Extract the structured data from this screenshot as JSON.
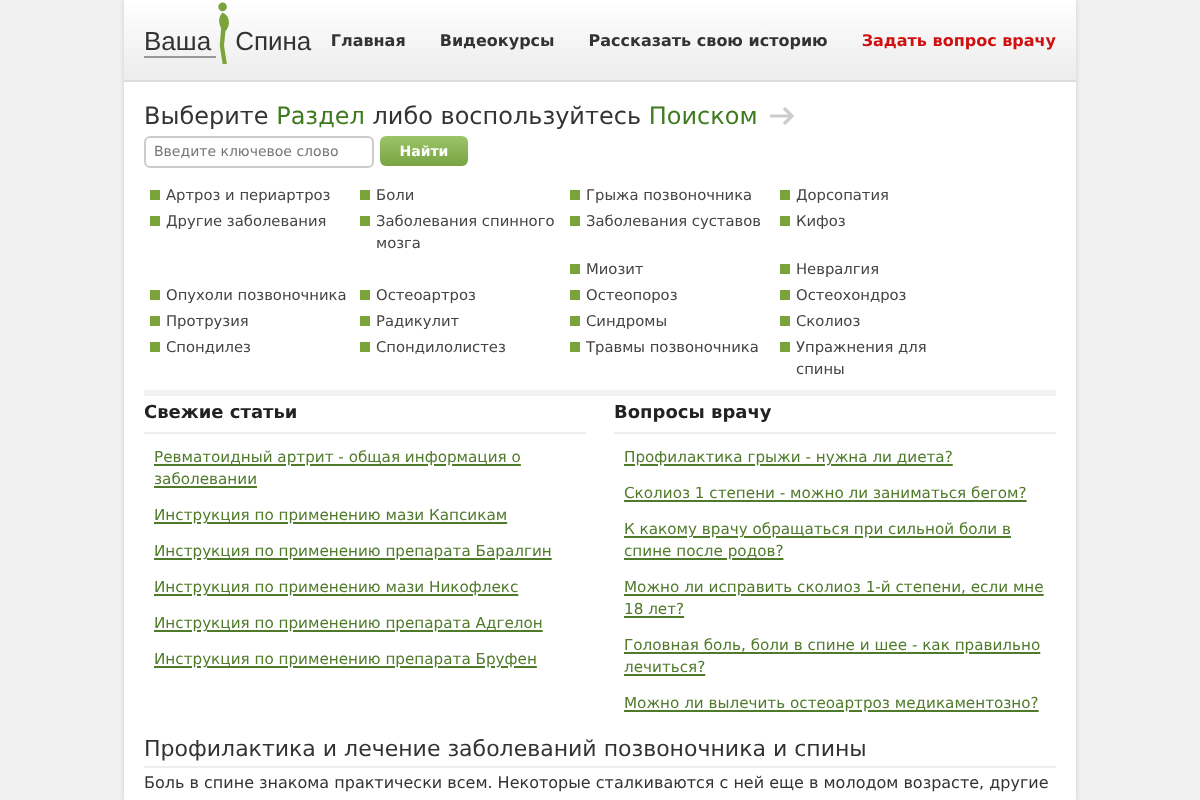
{
  "header": {
    "logo": {
      "word_1": "Ваша",
      "word_2": "Спина"
    },
    "nav": [
      {
        "label": "Главная",
        "highlight": false
      },
      {
        "label": "Видеокурсы",
        "highlight": false
      },
      {
        "label": "Рассказать свою историю",
        "highlight": false
      },
      {
        "label": "Задать вопрос врачу",
        "highlight": true
      }
    ]
  },
  "search": {
    "heading": [
      {
        "text": "Выберите ",
        "accent": false
      },
      {
        "text": "Раздел",
        "accent": true
      },
      {
        "text": " либо воспользуйтесь ",
        "accent": false
      },
      {
        "text": "Поиском",
        "accent": true
      }
    ],
    "placeholder": "Введите ключевое слово",
    "button": "Найти"
  },
  "categories": [
    {
      "column_1": "Артроз и периартроз",
      "column_2": "Боли",
      "column_3": "Грыжа позвоночника",
      "column_4": "Дорсопатия"
    },
    {
      "column_1": "Другие заболевания",
      "column_2": "Заболевания спинного мозга",
      "column_3": "Заболевания суставов",
      "column_4": "Кифоз"
    },
    {
      "column_3": "Миозит",
      "column_4": "Невралгия"
    },
    {
      "column_1": "Опухоли позвоночника",
      "column_2": "Остеоартроз",
      "column_3": "Остеопороз",
      "column_4": "Остеохондроз"
    },
    {
      "column_1": "Протрузия",
      "column_2": "Радикулит",
      "column_3": "Синдромы",
      "column_4": "Сколиоз"
    },
    {
      "column_1": "Спондилез",
      "column_2": "Спондилолистез",
      "column_3": "Травмы позвоночника",
      "column_4": "Упражнения для спины"
    }
  ],
  "fresh_articles": {
    "title": "Свежие статьи",
    "links": [
      "Ревматоидный артрит - общая информация о заболевании",
      "Инструкция по применению мази Капсикам",
      "Инструкция по применению препарата Баралгин",
      "Инструкция по применению мази Никофлекс",
      "Инструкция по применению препарата Адгелон",
      "Инструкция по применению препарата Бруфен"
    ]
  },
  "doctor_questions": {
    "title": "Вопросы врачу",
    "links": [
      "Профилактика грыжи - нужна ли диета?",
      "Сколиоз 1 степени - можно ли заниматься бегом?",
      "К какому врачу обращаться при сильной боли в спине после родов?",
      "Можно ли исправить сколиоз 1-й степени, если мне 18 лет?",
      "Головная боль, боли в спине и шее - как правильно лечиться?",
      "Можно ли вылечить остеоартроз медикаментозно?"
    ]
  },
  "article": {
    "title": "Профилактика и лечение заболеваний позвоночника и спины",
    "text": "Боль в спине знакома практически всем. Некоторые сталкиваются с ней еще в молодом возрасте, другие"
  }
}
